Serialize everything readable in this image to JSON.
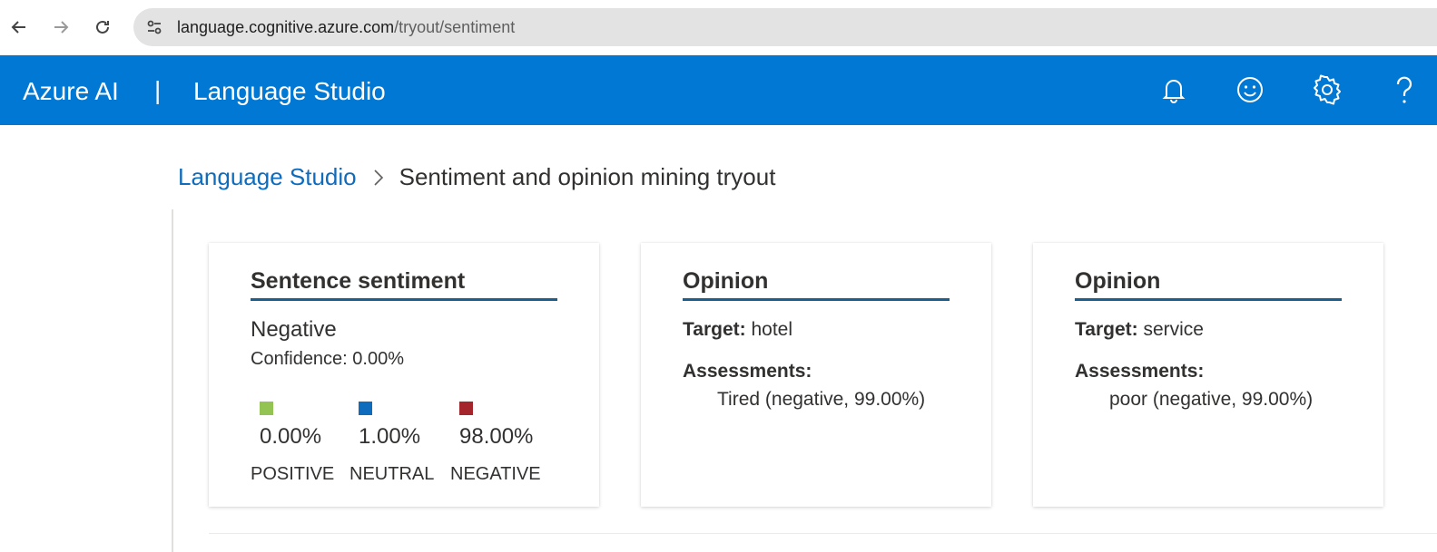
{
  "browser": {
    "url_host": "language.cognitive.azure.com",
    "url_path": "/tryout/sentiment"
  },
  "header": {
    "brand": "Azure AI",
    "separator": "|",
    "product": "Language Studio",
    "icons": [
      "bell-icon",
      "feedback-smiley-icon",
      "gear-icon",
      "help-icon"
    ],
    "color": "#0078d4"
  },
  "breadcrumb": {
    "root": "Language Studio",
    "current": "Sentiment and opinion mining tryout"
  },
  "sentence_card": {
    "title": "Sentence sentiment",
    "sentiment": "Negative",
    "confidence": "Confidence: 0.00%",
    "scores": [
      {
        "percent": "0.00%",
        "label": "POSITIVE",
        "color": "#92c353"
      },
      {
        "percent": "1.00%",
        "label": "NEUTRAL",
        "color": "#0f6cbd"
      },
      {
        "percent": "98.00%",
        "label": "NEGATIVE",
        "color": "#a4262c"
      }
    ]
  },
  "opinions": [
    {
      "title": "Opinion",
      "target_key": "Target:",
      "target_value": "hotel",
      "assessments_key": "Assessments:",
      "assessment": "Tired (negative, 99.00%)"
    },
    {
      "title": "Opinion",
      "target_key": "Target:",
      "target_value": "service",
      "assessments_key": "Assessments:",
      "assessment": "poor (negative, 99.00%)"
    }
  ]
}
